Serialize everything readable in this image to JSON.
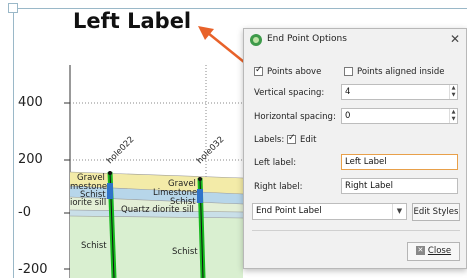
{
  "section": {
    "title": "Left Label",
    "y_ticks": [
      "400",
      "200",
      "-0",
      "-200"
    ],
    "holes": [
      "hole022",
      "hole032"
    ],
    "left_units": [
      "Gravel",
      "Limestone",
      "Schist",
      "Quartz diorite sill"
    ],
    "left_units_display": [
      "Gravel",
      "mestone",
      "Schist",
      "iorite sill"
    ],
    "right_units": [
      "Gravel",
      "Limestone",
      "Schist",
      "Quartz diorite sill"
    ],
    "lower_unit": "Schist",
    "colors": {
      "gravel": "#f3eba8",
      "limestone": "#b7d6ea",
      "schist": "#d9efd0",
      "diorite": "#c9dfe8",
      "hole": "#16b81e",
      "arrow": "#e8622a"
    }
  },
  "dialog": {
    "title": "End Point Options",
    "close_icon": "close-icon",
    "points_above": "Points above",
    "points_above_checked": true,
    "points_aligned_inside": "Points aligned inside",
    "points_aligned_inside_checked": false,
    "vertical_spacing_label": "Vertical spacing:",
    "vertical_spacing_value": "4",
    "horizontal_spacing_label": "Horizontal spacing:",
    "horizontal_spacing_value": "0",
    "labels_label": "Labels:",
    "edit_label": "Edit",
    "edit_checked": true,
    "left_label_label": "Left label:",
    "left_label_value": "Left Label",
    "right_label_label": "Right label:",
    "right_label_value": "Right Label",
    "style_select_value": "End Point Label",
    "edit_styles_button": "Edit Styles",
    "close_button": "Close"
  }
}
